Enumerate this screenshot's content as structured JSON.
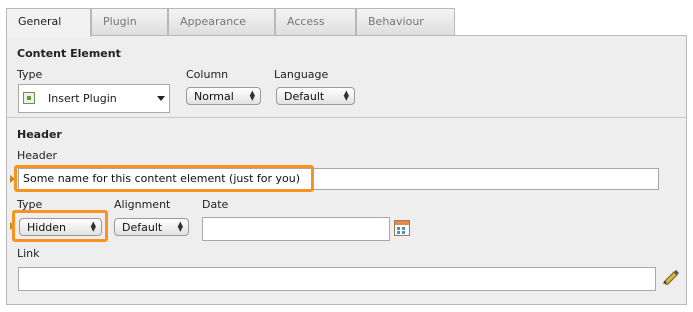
{
  "tabs": [
    "General",
    "Plugin",
    "Appearance",
    "Access",
    "Behaviour"
  ],
  "active_tab": "General",
  "content_element": {
    "title": "Content Element",
    "type_label": "Type",
    "type_value": "Insert Plugin",
    "column_label": "Column",
    "column_value": "Normal",
    "language_label": "Language",
    "language_value": "Default"
  },
  "header": {
    "title": "Header",
    "header_label": "Header",
    "header_value": "Some name for this content element (just for you)",
    "type_label": "Type",
    "type_value": "Hidden",
    "alignment_label": "Alignment",
    "alignment_value": "Default",
    "date_label": "Date",
    "date_value": "",
    "link_label": "Link",
    "link_value": ""
  },
  "colors": {
    "highlight": "#f7931e",
    "panel_bg": "#eeeeee"
  },
  "icons": [
    "plugin-icon",
    "calendar-icon",
    "link-wizard-icon"
  ]
}
